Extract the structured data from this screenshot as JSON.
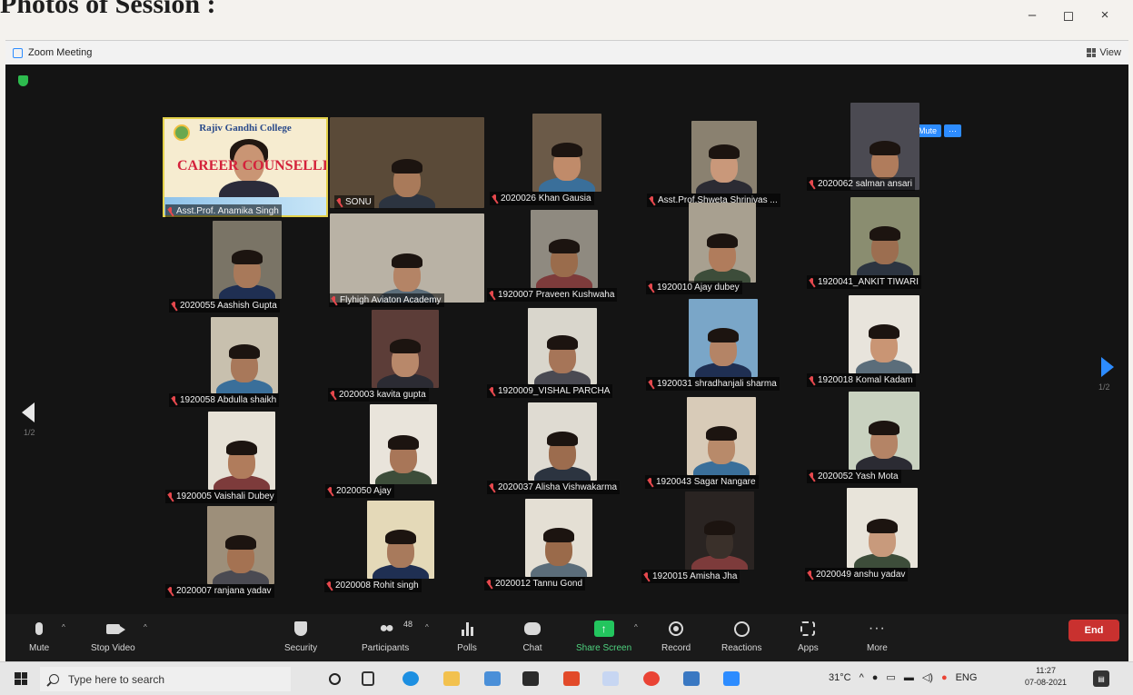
{
  "document": {
    "heading": "Photos of Session :"
  },
  "window_controls": {
    "minimize": "–",
    "maximize": "◻",
    "close": "×"
  },
  "titlebar": {
    "title": "Zoom Meeting",
    "view_label": "View"
  },
  "host_tile": {
    "college_name": "Rajiv Gandhi College",
    "banner": "CAREER COUNSELLING",
    "name": "Asst.Prof. Anamika Singh"
  },
  "self_controls": {
    "mute": "Mute",
    "more": "···"
  },
  "participants": [
    {
      "name": "SONU"
    },
    {
      "name": "2020026 Khan Gausia"
    },
    {
      "name": "Asst.Prof.Shweta Shrinivas ..."
    },
    {
      "name": "2020062 salman ansari"
    },
    {
      "name": "2020055 Aashish Gupta"
    },
    {
      "name": "Flyhigh Aviaton Academy"
    },
    {
      "name": "1920007 Praveen Kushwaha"
    },
    {
      "name": "1920010 Ajay dubey"
    },
    {
      "name": "1920041_ANKIT TIWARI"
    },
    {
      "name": "1920058 Abdulla shaikh"
    },
    {
      "name": "2020003 kavita gupta"
    },
    {
      "name": "1920009_VISHAL PARCHA"
    },
    {
      "name": "1920031 shradhanjali sharma"
    },
    {
      "name": "1920018 Komal Kadam"
    },
    {
      "name": "1920005 Vaishali Dubey"
    },
    {
      "name": "2020050 Ajay"
    },
    {
      "name": "2020037 Alisha Vishwakarma"
    },
    {
      "name": "1920043 Sagar Nangare"
    },
    {
      "name": "2020052 Yash Mota"
    },
    {
      "name": "2020007 ranjana yadav"
    },
    {
      "name": "2020008 Rohit singh"
    },
    {
      "name": "2020012 Tannu Gond"
    },
    {
      "name": "1920015 Amisha Jha"
    },
    {
      "name": "2020049 anshu yadav"
    }
  ],
  "pagination": {
    "left": "1/2",
    "right": "1/2"
  },
  "toolbar": {
    "mute": "Mute",
    "stop_video": "Stop Video",
    "security": "Security",
    "participants": "Participants",
    "participant_count": "48",
    "polls": "Polls",
    "chat": "Chat",
    "share_screen": "Share Screen",
    "record": "Record",
    "reactions": "Reactions",
    "apps": "Apps",
    "more": "More",
    "end": "End"
  },
  "taskbar": {
    "search_placeholder": "Type here to search",
    "temperature": "31°C",
    "language": "ENG",
    "time": "11:27",
    "date": "07-08-2021"
  },
  "colors": {
    "accent": "#2d8cff",
    "end": "#c9312f",
    "share": "#23c55e",
    "muted": "#e5484d"
  }
}
